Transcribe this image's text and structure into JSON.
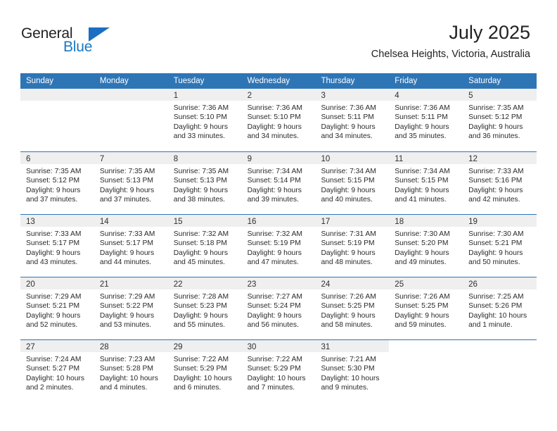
{
  "brand": {
    "name_top": "General",
    "name_bottom": "Blue",
    "accent_color": "#1b6ec2"
  },
  "header": {
    "title": "July 2025",
    "subtitle": "Chelsea Heights, Victoria, Australia"
  },
  "theme": {
    "header_row_bg": "#2e75b6",
    "daynum_band_bg": "#efefef",
    "separator_color": "#2e75b6"
  },
  "weekdays": [
    "Sunday",
    "Monday",
    "Tuesday",
    "Wednesday",
    "Thursday",
    "Friday",
    "Saturday"
  ],
  "weeks": [
    {
      "days": [
        {
          "num": "",
          "blank": true,
          "shaded": true,
          "sunrise": "",
          "sunset": "",
          "daylight1": "",
          "daylight2": ""
        },
        {
          "num": "",
          "blank": true,
          "shaded": true,
          "sunrise": "",
          "sunset": "",
          "daylight1": "",
          "daylight2": ""
        },
        {
          "num": "1",
          "blank": false,
          "shaded": true,
          "sunrise": "Sunrise: 7:36 AM",
          "sunset": "Sunset: 5:10 PM",
          "daylight1": "Daylight: 9 hours",
          "daylight2": "and 33 minutes."
        },
        {
          "num": "2",
          "blank": false,
          "shaded": true,
          "sunrise": "Sunrise: 7:36 AM",
          "sunset": "Sunset: 5:10 PM",
          "daylight1": "Daylight: 9 hours",
          "daylight2": "and 34 minutes."
        },
        {
          "num": "3",
          "blank": false,
          "shaded": true,
          "sunrise": "Sunrise: 7:36 AM",
          "sunset": "Sunset: 5:11 PM",
          "daylight1": "Daylight: 9 hours",
          "daylight2": "and 34 minutes."
        },
        {
          "num": "4",
          "blank": false,
          "shaded": true,
          "sunrise": "Sunrise: 7:36 AM",
          "sunset": "Sunset: 5:11 PM",
          "daylight1": "Daylight: 9 hours",
          "daylight2": "and 35 minutes."
        },
        {
          "num": "5",
          "blank": false,
          "shaded": true,
          "sunrise": "Sunrise: 7:35 AM",
          "sunset": "Sunset: 5:12 PM",
          "daylight1": "Daylight: 9 hours",
          "daylight2": "and 36 minutes."
        }
      ]
    },
    {
      "days": [
        {
          "num": "6",
          "blank": false,
          "shaded": true,
          "sunrise": "Sunrise: 7:35 AM",
          "sunset": "Sunset: 5:12 PM",
          "daylight1": "Daylight: 9 hours",
          "daylight2": "and 37 minutes."
        },
        {
          "num": "7",
          "blank": false,
          "shaded": true,
          "sunrise": "Sunrise: 7:35 AM",
          "sunset": "Sunset: 5:13 PM",
          "daylight1": "Daylight: 9 hours",
          "daylight2": "and 37 minutes."
        },
        {
          "num": "8",
          "blank": false,
          "shaded": true,
          "sunrise": "Sunrise: 7:35 AM",
          "sunset": "Sunset: 5:13 PM",
          "daylight1": "Daylight: 9 hours",
          "daylight2": "and 38 minutes."
        },
        {
          "num": "9",
          "blank": false,
          "shaded": true,
          "sunrise": "Sunrise: 7:34 AM",
          "sunset": "Sunset: 5:14 PM",
          "daylight1": "Daylight: 9 hours",
          "daylight2": "and 39 minutes."
        },
        {
          "num": "10",
          "blank": false,
          "shaded": true,
          "sunrise": "Sunrise: 7:34 AM",
          "sunset": "Sunset: 5:15 PM",
          "daylight1": "Daylight: 9 hours",
          "daylight2": "and 40 minutes."
        },
        {
          "num": "11",
          "blank": false,
          "shaded": true,
          "sunrise": "Sunrise: 7:34 AM",
          "sunset": "Sunset: 5:15 PM",
          "daylight1": "Daylight: 9 hours",
          "daylight2": "and 41 minutes."
        },
        {
          "num": "12",
          "blank": false,
          "shaded": true,
          "sunrise": "Sunrise: 7:33 AM",
          "sunset": "Sunset: 5:16 PM",
          "daylight1": "Daylight: 9 hours",
          "daylight2": "and 42 minutes."
        }
      ]
    },
    {
      "days": [
        {
          "num": "13",
          "blank": false,
          "shaded": true,
          "sunrise": "Sunrise: 7:33 AM",
          "sunset": "Sunset: 5:17 PM",
          "daylight1": "Daylight: 9 hours",
          "daylight2": "and 43 minutes."
        },
        {
          "num": "14",
          "blank": false,
          "shaded": true,
          "sunrise": "Sunrise: 7:33 AM",
          "sunset": "Sunset: 5:17 PM",
          "daylight1": "Daylight: 9 hours",
          "daylight2": "and 44 minutes."
        },
        {
          "num": "15",
          "blank": false,
          "shaded": true,
          "sunrise": "Sunrise: 7:32 AM",
          "sunset": "Sunset: 5:18 PM",
          "daylight1": "Daylight: 9 hours",
          "daylight2": "and 45 minutes."
        },
        {
          "num": "16",
          "blank": false,
          "shaded": true,
          "sunrise": "Sunrise: 7:32 AM",
          "sunset": "Sunset: 5:19 PM",
          "daylight1": "Daylight: 9 hours",
          "daylight2": "and 47 minutes."
        },
        {
          "num": "17",
          "blank": false,
          "shaded": true,
          "sunrise": "Sunrise: 7:31 AM",
          "sunset": "Sunset: 5:19 PM",
          "daylight1": "Daylight: 9 hours",
          "daylight2": "and 48 minutes."
        },
        {
          "num": "18",
          "blank": false,
          "shaded": true,
          "sunrise": "Sunrise: 7:30 AM",
          "sunset": "Sunset: 5:20 PM",
          "daylight1": "Daylight: 9 hours",
          "daylight2": "and 49 minutes."
        },
        {
          "num": "19",
          "blank": false,
          "shaded": true,
          "sunrise": "Sunrise: 7:30 AM",
          "sunset": "Sunset: 5:21 PM",
          "daylight1": "Daylight: 9 hours",
          "daylight2": "and 50 minutes."
        }
      ]
    },
    {
      "days": [
        {
          "num": "20",
          "blank": false,
          "shaded": true,
          "sunrise": "Sunrise: 7:29 AM",
          "sunset": "Sunset: 5:21 PM",
          "daylight1": "Daylight: 9 hours",
          "daylight2": "and 52 minutes."
        },
        {
          "num": "21",
          "blank": false,
          "shaded": true,
          "sunrise": "Sunrise: 7:29 AM",
          "sunset": "Sunset: 5:22 PM",
          "daylight1": "Daylight: 9 hours",
          "daylight2": "and 53 minutes."
        },
        {
          "num": "22",
          "blank": false,
          "shaded": true,
          "sunrise": "Sunrise: 7:28 AM",
          "sunset": "Sunset: 5:23 PM",
          "daylight1": "Daylight: 9 hours",
          "daylight2": "and 55 minutes."
        },
        {
          "num": "23",
          "blank": false,
          "shaded": true,
          "sunrise": "Sunrise: 7:27 AM",
          "sunset": "Sunset: 5:24 PM",
          "daylight1": "Daylight: 9 hours",
          "daylight2": "and 56 minutes."
        },
        {
          "num": "24",
          "blank": false,
          "shaded": true,
          "sunrise": "Sunrise: 7:26 AM",
          "sunset": "Sunset: 5:25 PM",
          "daylight1": "Daylight: 9 hours",
          "daylight2": "and 58 minutes."
        },
        {
          "num": "25",
          "blank": false,
          "shaded": true,
          "sunrise": "Sunrise: 7:26 AM",
          "sunset": "Sunset: 5:25 PM",
          "daylight1": "Daylight: 9 hours",
          "daylight2": "and 59 minutes."
        },
        {
          "num": "26",
          "blank": false,
          "shaded": true,
          "sunrise": "Sunrise: 7:25 AM",
          "sunset": "Sunset: 5:26 PM",
          "daylight1": "Daylight: 10 hours",
          "daylight2": "and 1 minute."
        }
      ]
    },
    {
      "days": [
        {
          "num": "27",
          "blank": false,
          "shaded": true,
          "sunrise": "Sunrise: 7:24 AM",
          "sunset": "Sunset: 5:27 PM",
          "daylight1": "Daylight: 10 hours",
          "daylight2": "and 2 minutes."
        },
        {
          "num": "28",
          "blank": false,
          "shaded": true,
          "sunrise": "Sunrise: 7:23 AM",
          "sunset": "Sunset: 5:28 PM",
          "daylight1": "Daylight: 10 hours",
          "daylight2": "and 4 minutes."
        },
        {
          "num": "29",
          "blank": false,
          "shaded": true,
          "sunrise": "Sunrise: 7:22 AM",
          "sunset": "Sunset: 5:29 PM",
          "daylight1": "Daylight: 10 hours",
          "daylight2": "and 6 minutes."
        },
        {
          "num": "30",
          "blank": false,
          "shaded": true,
          "sunrise": "Sunrise: 7:22 AM",
          "sunset": "Sunset: 5:29 PM",
          "daylight1": "Daylight: 10 hours",
          "daylight2": "and 7 minutes."
        },
        {
          "num": "31",
          "blank": false,
          "shaded": true,
          "sunrise": "Sunrise: 7:21 AM",
          "sunset": "Sunset: 5:30 PM",
          "daylight1": "Daylight: 10 hours",
          "daylight2": "and 9 minutes."
        },
        {
          "num": "",
          "blank": true,
          "shaded": false,
          "sunrise": "",
          "sunset": "",
          "daylight1": "",
          "daylight2": ""
        },
        {
          "num": "",
          "blank": true,
          "shaded": false,
          "sunrise": "",
          "sunset": "",
          "daylight1": "",
          "daylight2": ""
        }
      ]
    }
  ]
}
